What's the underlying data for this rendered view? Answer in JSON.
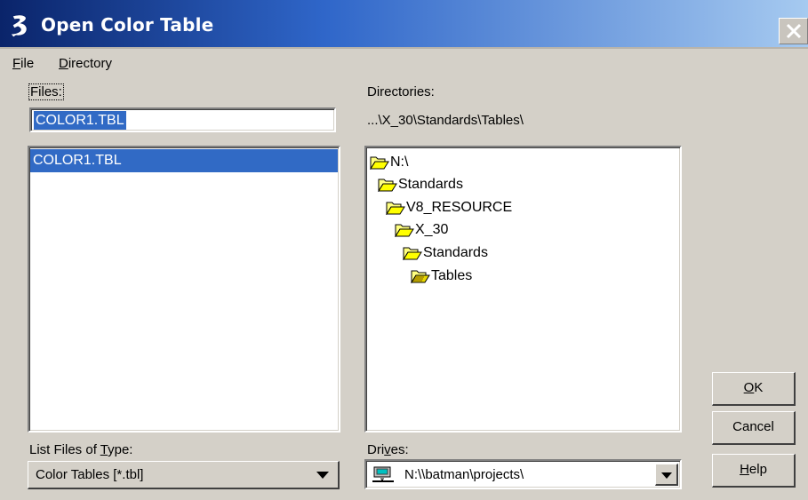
{
  "window": {
    "title": "Open Color Table",
    "app_icon": "microstation-icon",
    "close_icon": "close-icon"
  },
  "menu": {
    "file": {
      "accel": "F",
      "rest": "ile"
    },
    "directory": {
      "accel": "D",
      "rest": "irectory"
    }
  },
  "files": {
    "label": "Files:",
    "input_value": "COLOR1.TBL",
    "list": [
      "COLOR1.TBL"
    ]
  },
  "directories": {
    "label": "Directories:",
    "current_path": "...\\X_30\\Standards\\Tables\\",
    "tree": [
      {
        "name": "N:\\",
        "icon": "open-folder-icon"
      },
      {
        "name": "Standards",
        "icon": "open-folder-icon"
      },
      {
        "name": "V8_RESOURCE",
        "icon": "open-folder-icon"
      },
      {
        "name": "X_30",
        "icon": "open-folder-icon"
      },
      {
        "name": "Standards",
        "icon": "open-folder-icon"
      },
      {
        "name": "Tables",
        "icon": "open-folder-selected-icon"
      }
    ]
  },
  "file_type": {
    "label_pre": "List Files of ",
    "label_accel": "T",
    "label_post": "ype:",
    "selected": "Color Tables [*.tbl]"
  },
  "drives": {
    "label_pre": "Dri",
    "label_accel": "v",
    "label_post": "es:",
    "selected": "N:\\\\batman\\projects\\",
    "icon": "network-drive-icon"
  },
  "buttons": {
    "ok": {
      "accel": "O",
      "rest": "K"
    },
    "cancel": "Cancel",
    "help": {
      "accel": "H",
      "rest": "elp"
    }
  },
  "colors": {
    "titlebar_start": "#0a246a",
    "titlebar_end": "#a6caf0",
    "selection": "#316ac5",
    "dialog_bg": "#d4d0c8",
    "folder": "#ffff00"
  }
}
